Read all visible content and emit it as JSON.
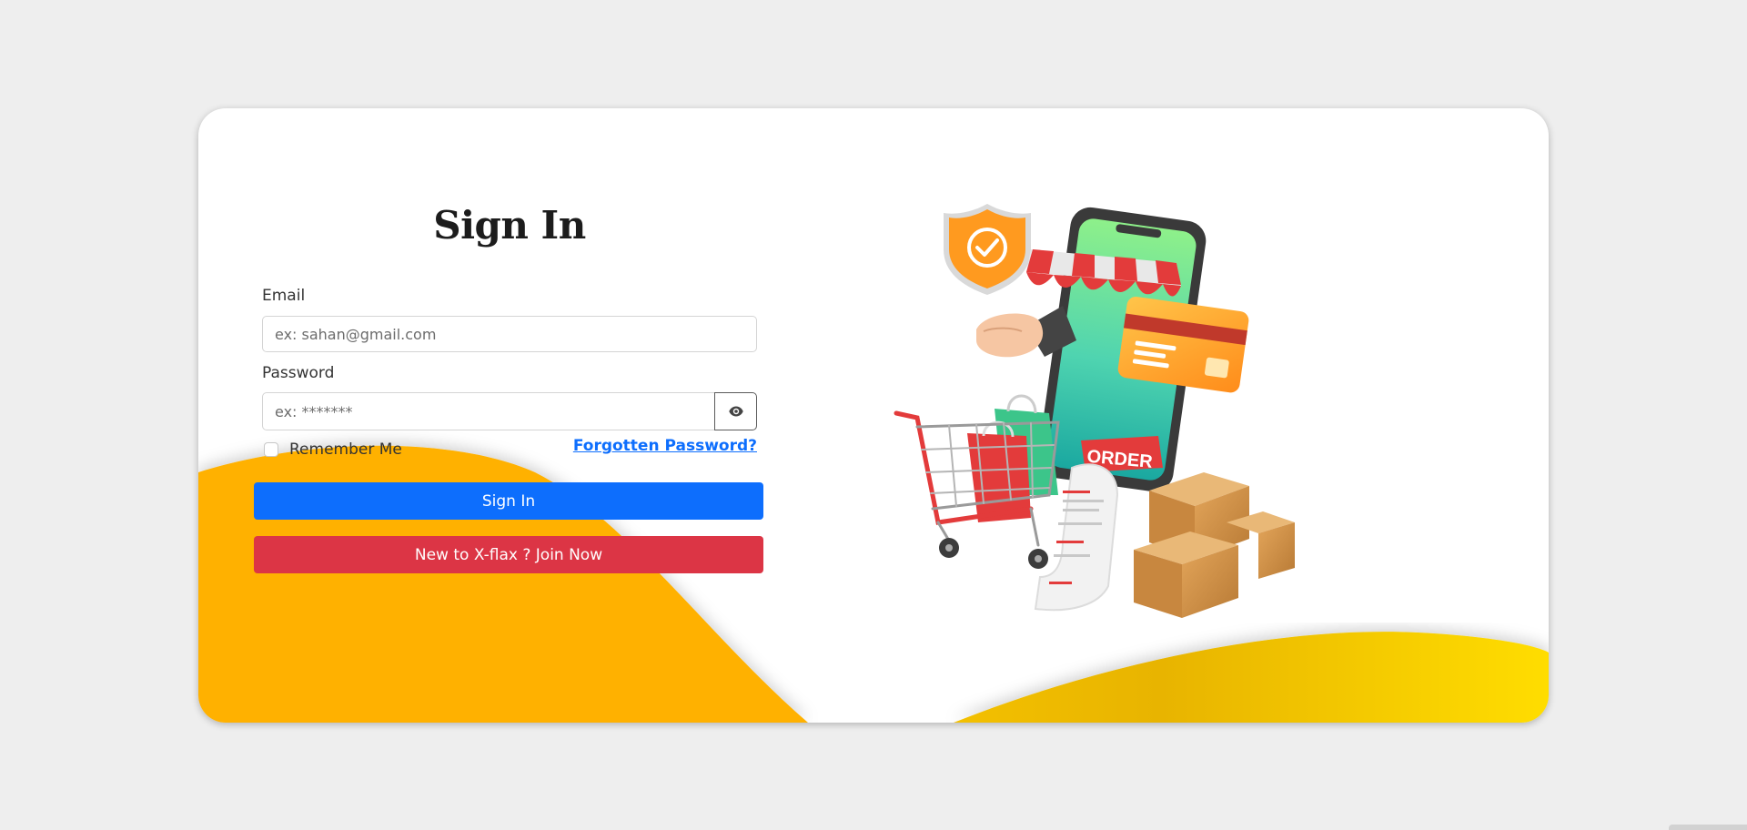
{
  "login": {
    "title": "Sign In",
    "email_label": "Email",
    "email_placeholder": "ex: sahan@gmail.com",
    "password_label": "Password",
    "password_placeholder": "ex: *******",
    "remember_label": "Remember Me",
    "forgot_label": "Forgotten Password?",
    "signin_button": "Sign In",
    "join_button": "New to X-flax ? Join Now"
  },
  "illustration": {
    "order_tag": "ORDER"
  },
  "icons": {
    "password_toggle": "eye-icon"
  },
  "colors": {
    "primary": "#0d6efd",
    "danger": "#dc3545",
    "wave_orange": "#ffb100",
    "wave_yellow": "#ffd900"
  }
}
